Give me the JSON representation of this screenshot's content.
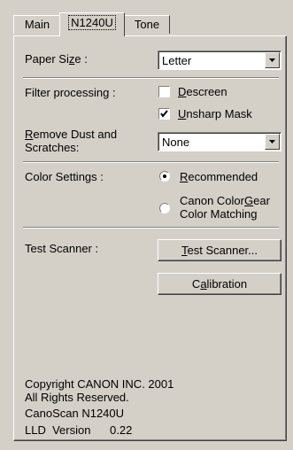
{
  "tabs": [
    {
      "label": "Main"
    },
    {
      "label": "N1240U"
    },
    {
      "label": "Tone"
    }
  ],
  "paper_size": {
    "label_pre": "Paper Si",
    "label_key": "z",
    "label_post": "e :",
    "value": "Letter"
  },
  "filter": {
    "label": "Filter processing :",
    "descreen": {
      "key": "D",
      "rest": "escreen",
      "checked": false
    },
    "unsharp": {
      "key": "U",
      "rest": "nsharp Mask",
      "checked": true
    }
  },
  "dust": {
    "label_key": "R",
    "label_line1_rest": "emove Dust and",
    "label_line2": "Scratches:",
    "value": "None"
  },
  "color": {
    "label": "Color Settings :",
    "recommended": {
      "key": "R",
      "rest": "ecommended",
      "selected": true
    },
    "colorgear": {
      "line1_pre": "Canon Color",
      "line1_key": "G",
      "line1_post": "ear",
      "line2": "Color Matching",
      "selected": false
    }
  },
  "test": {
    "label": "Test Scanner :",
    "test_button": {
      "key": "T",
      "rest": "est Scanner..."
    },
    "calibration_button": {
      "pre": "C",
      "key": "a",
      "rest": "libration"
    }
  },
  "info": {
    "copyright": "Copyright CANON INC. 2001",
    "rights": "All Rights Reserved.",
    "model": "CanoScan N1240U",
    "lld_label": "LLD  Version",
    "lld_value": "0.22"
  }
}
